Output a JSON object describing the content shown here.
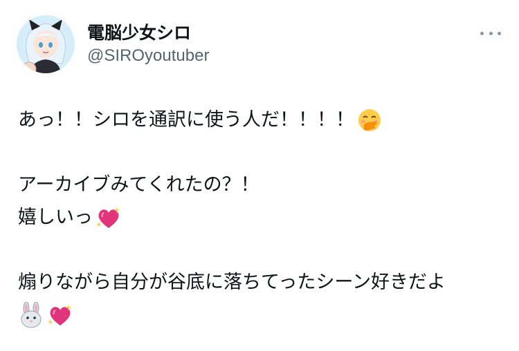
{
  "tweet": {
    "author": {
      "display_name": "電脳少女シロ",
      "handle": "@SIROyoutuber",
      "avatar_icon": "avatar-icon"
    },
    "more_icon": "more-options-icon",
    "lines": [
      {
        "text": "あっ！！シロを通訳に使う人だ！！！！",
        "emoji": "face-with-hand-over-mouth-icon"
      },
      {
        "text": ""
      },
      {
        "text": "アーカイブみてくれたの？！",
        "emoji": ""
      },
      {
        "text": "嬉しいっ",
        "emoji": "sparkling-heart-icon"
      },
      {
        "text": ""
      },
      {
        "text": "煽りながら自分が谷底に落ちてったシーン好きだよ",
        "emoji": ""
      },
      {
        "text": "",
        "emoji": "rabbit-face-icon sparkling-heart-icon"
      }
    ]
  }
}
